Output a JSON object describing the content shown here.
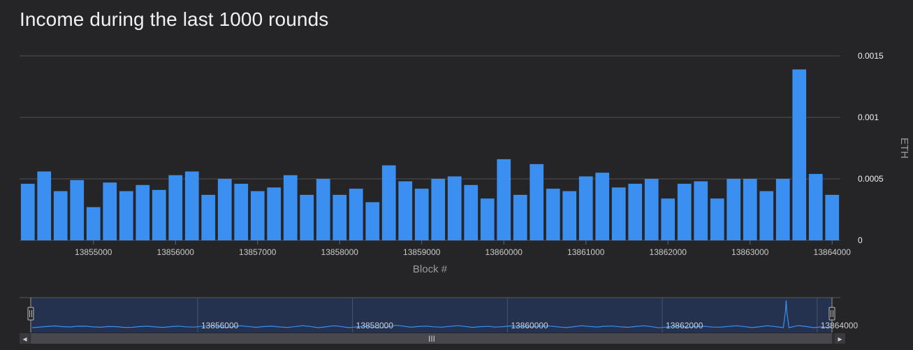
{
  "title": "Income during the last 1000 rounds",
  "colors": {
    "background": "#252427",
    "bar": "#3a8ff0",
    "grid": "#505050",
    "navigator_mask": "#24324f"
  },
  "chart_data": {
    "type": "bar",
    "title": "Income during the last 1000 rounds",
    "xlabel": "Block #",
    "ylabel": "ETH",
    "xlim": [
      13854100,
      13864100
    ],
    "ylim": [
      0,
      0.0015
    ],
    "x_ticks": [
      "13855000",
      "13856000",
      "13857000",
      "13858000",
      "13859000",
      "13860000",
      "13861000",
      "13862000",
      "13863000",
      "13864000"
    ],
    "y_ticks": [
      "0",
      "0.0005",
      "0.001",
      "0.0015"
    ],
    "grid": true,
    "legend": "none",
    "x": [
      13854200,
      13854400,
      13854600,
      13854800,
      13855000,
      13855200,
      13855400,
      13855600,
      13855800,
      13856000,
      13856200,
      13856400,
      13856600,
      13856800,
      13857000,
      13857200,
      13857400,
      13857600,
      13857800,
      13858000,
      13858200,
      13858400,
      13858600,
      13858800,
      13859000,
      13859200,
      13859400,
      13859600,
      13859800,
      13860000,
      13860200,
      13860400,
      13860600,
      13860800,
      13861000,
      13861200,
      13861400,
      13861600,
      13861800,
      13862000,
      13862200,
      13862400,
      13862600,
      13862800,
      13863000,
      13863200,
      13863400,
      13863600,
      13863800,
      13864000
    ],
    "values": [
      0.00046,
      0.00056,
      0.0004,
      0.00049,
      0.00027,
      0.00047,
      0.0004,
      0.00045,
      0.00041,
      0.00053,
      0.00056,
      0.00037,
      0.0005,
      0.00046,
      0.0004,
      0.00043,
      0.00053,
      0.00037,
      0.0005,
      0.00037,
      0.00042,
      0.00031,
      0.00061,
      0.00048,
      0.00042,
      0.0005,
      0.00052,
      0.00045,
      0.00034,
      0.00066,
      0.00037,
      0.00062,
      0.00042,
      0.0004,
      0.00052,
      0.00055,
      0.00043,
      0.00046,
      0.0005,
      0.00034,
      0.00046,
      0.00048,
      0.00034,
      0.0005,
      0.0005,
      0.0004,
      0.0005,
      0.00139,
      0.00054,
      0.00037
    ]
  },
  "navigator": {
    "labels": [
      "13856000",
      "13858000",
      "13860000",
      "13862000",
      "13864000"
    ],
    "scroll_thumb": "III",
    "left_arrow": "◂",
    "right_arrow": "▸",
    "handle_glyph": "II"
  }
}
